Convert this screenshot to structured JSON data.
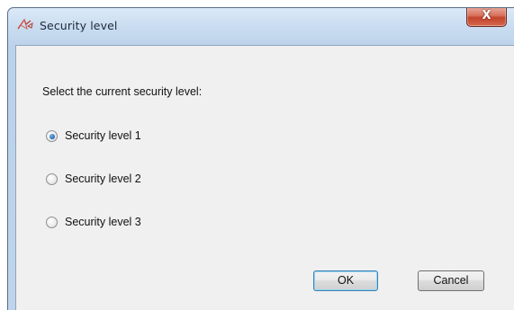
{
  "window": {
    "title": "Security level",
    "title_icon": "security-wand-icon",
    "close_glyph": "X",
    "close_icon": "close-icon"
  },
  "dialog": {
    "prompt": "Select the current security level:",
    "options": [
      {
        "label": "Security level 1",
        "checked": true
      },
      {
        "label": "Security level 2",
        "checked": false
      },
      {
        "label": "Security level 3",
        "checked": false
      }
    ],
    "ok_label": "OK",
    "cancel_label": "Cancel"
  },
  "colors": {
    "close_button": "#c4432c",
    "default_button_border": "#3c7fb1",
    "client_background": "#f0f0f0"
  }
}
